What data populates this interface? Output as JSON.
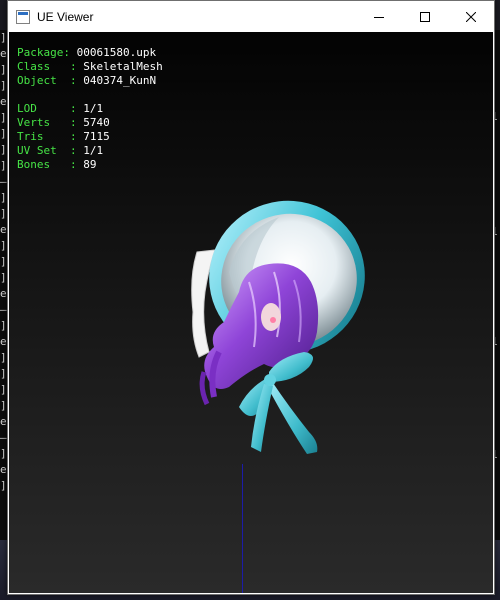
{
  "window": {
    "title": "UE Viewer"
  },
  "info_panel": {
    "rows_group1": [
      {
        "label": "Package: ",
        "value": "00061580.upk"
      },
      {
        "label": "Class   : ",
        "value": "SkeletalMesh"
      },
      {
        "label": "Object  : ",
        "value": "040374_KunN"
      }
    ],
    "rows_group2": [
      {
        "label": "LOD     : ",
        "value": "1/1"
      },
      {
        "label": "Verts   : ",
        "value": "5740"
      },
      {
        "label": "Tris    : ",
        "value": "7115"
      },
      {
        "label": "UV Set  : ",
        "value": "1/1"
      },
      {
        "label": "Bones   : ",
        "value": "89"
      }
    ]
  },
  "background_console": {
    "left_glyphs": [
      "]",
      "e",
      "]",
      "]",
      "e",
      "]",
      "]",
      "]",
      "]",
      "—",
      "]",
      "]",
      "e",
      "]",
      "]",
      "]",
      "e",
      "—",
      "]",
      "e",
      "]",
      "]",
      "]",
      "]",
      "e",
      "—",
      "]",
      "e",
      "]"
    ],
    "right_glyphs": [
      "1",
      "1",
      "1",
      "1"
    ]
  },
  "colors": {
    "label_green": "#46e446",
    "value_white": "#ffffff",
    "axis_blue": "#1c1ca8"
  },
  "icons": {
    "app": "window-app-icon",
    "minimize": "minimize-icon",
    "maximize": "maximize-icon",
    "close": "close-icon"
  }
}
